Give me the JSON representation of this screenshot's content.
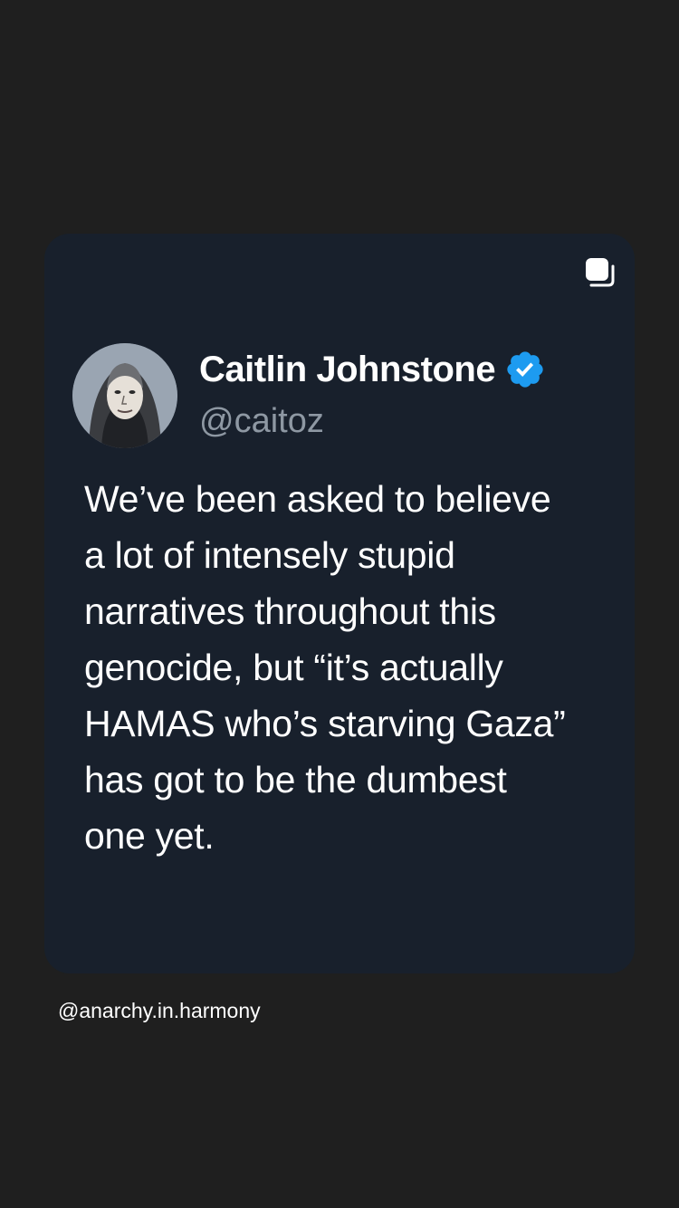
{
  "post": {
    "author": {
      "name": "Caitlin Johnstone",
      "handle": "@caitoz",
      "verified": true,
      "avatar_icon": "portrait-avatar-icon"
    },
    "text_lines": [
      "We’ve been asked to believe",
      "a lot of intensely stupid",
      "narratives throughout this",
      "genocide, but “it’s actually",
      "HAMAS who’s starving Gaza”",
      "has got to be the dumbest",
      "one yet."
    ],
    "copy_icon": "copy-icon"
  },
  "credit": {
    "text": "@anarchy.in.harmony"
  },
  "colors": {
    "page_background": "#1f1f1f",
    "card_background": "#18202c",
    "text_primary": "#ffffff",
    "text_secondary": "#8e98a3",
    "verified_badge": "#1d9bf0"
  }
}
